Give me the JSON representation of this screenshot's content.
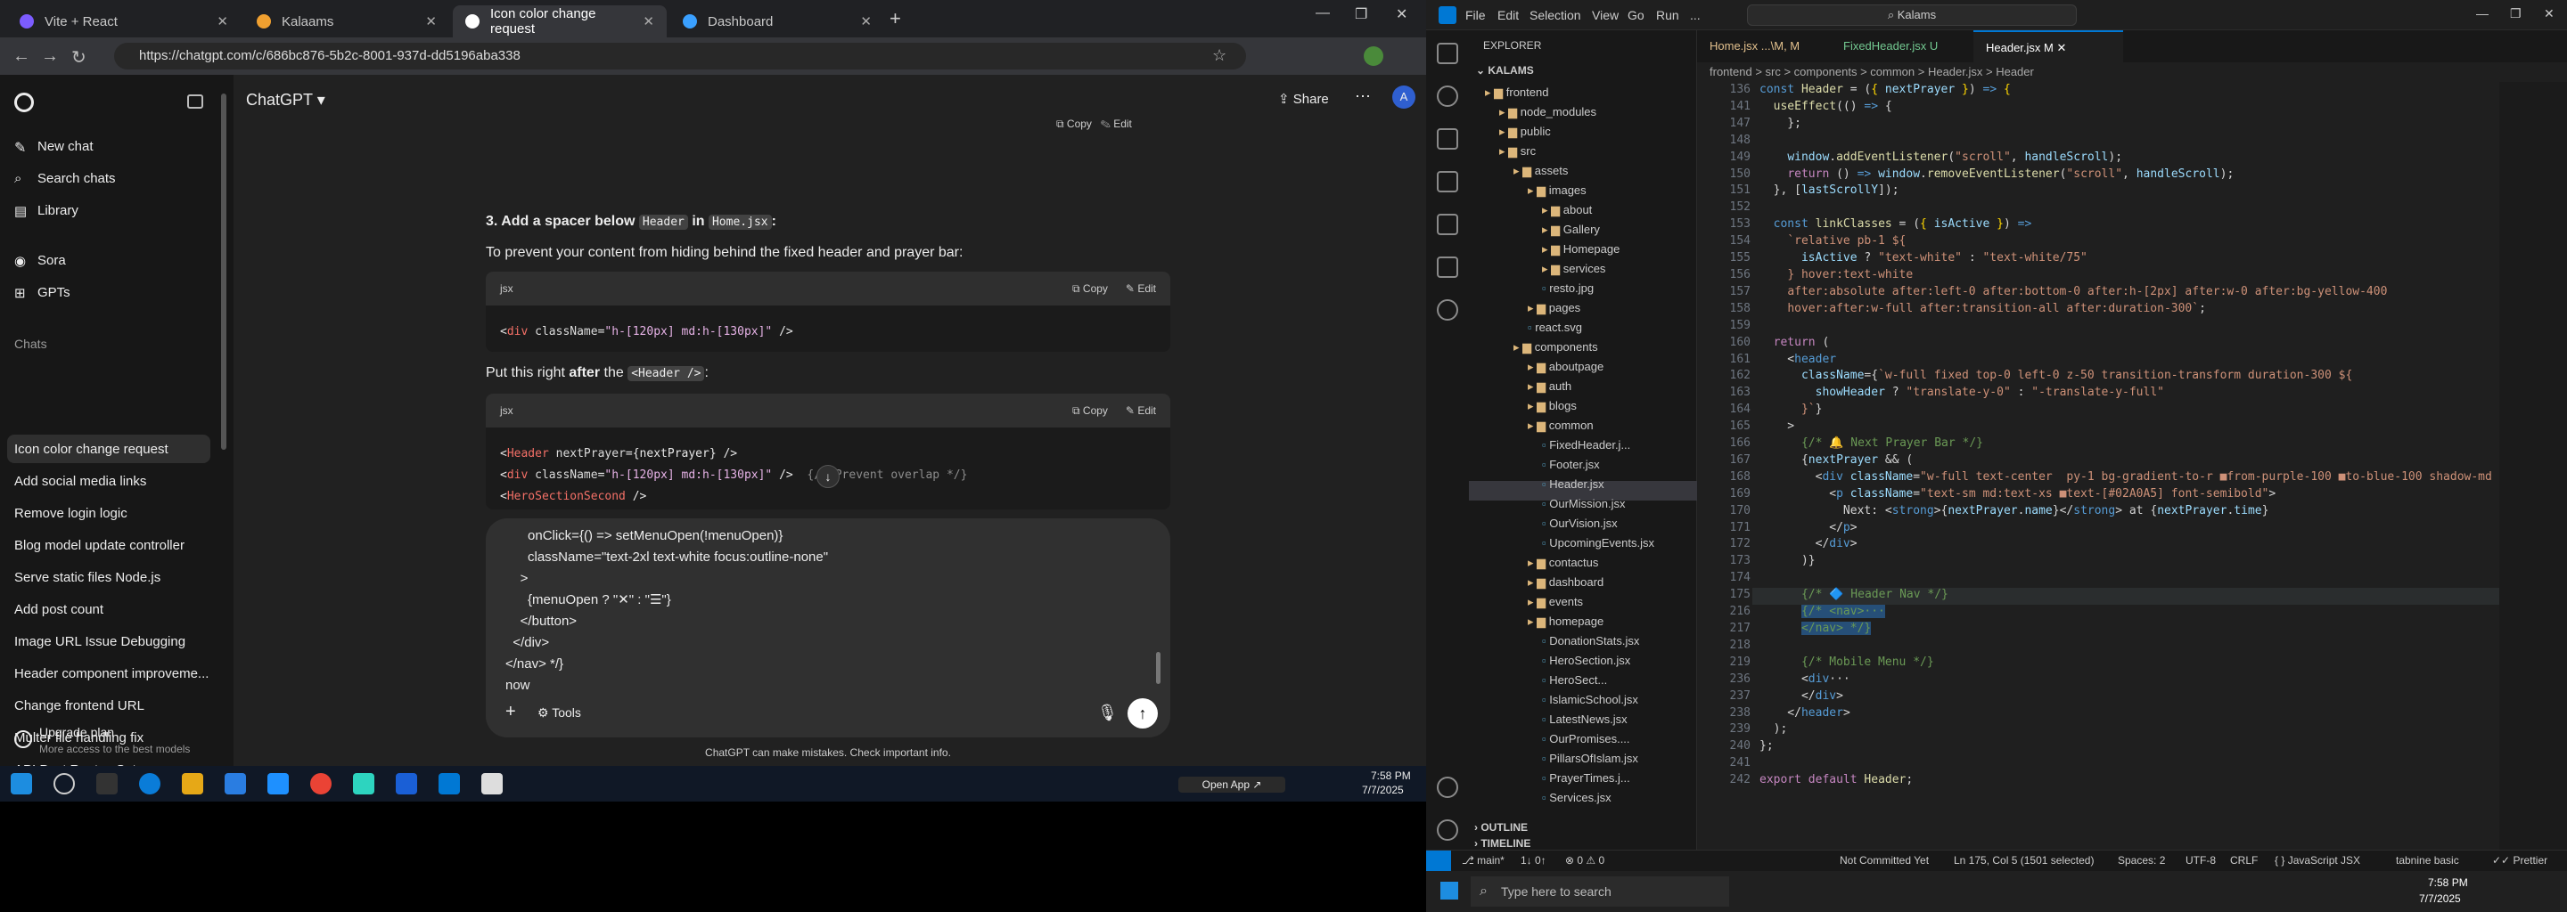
{
  "browser": {
    "tabs": [
      "Vite + React",
      "Kalaams",
      "Icon color change request",
      "Dashboard"
    ],
    "url": "https://chatgpt.com/c/686bc876-5b2c-8001-937d-dd5196aba338"
  },
  "chatgpt": {
    "brand": "ChatGPT",
    "nav": [
      "New chat",
      "Search chats",
      "Library",
      "Sora",
      "GPTs"
    ],
    "chats_heading": "Chats",
    "chats": [
      "Icon color change request",
      "Add social media links",
      "Remove login logic",
      "Blog model update controller",
      "Serve static files Node.js",
      "Add post count",
      "Image URL Issue Debugging",
      "Header component improveme...",
      "Change frontend URL",
      "Multer file handling fix",
      "API Post Routes Setup"
    ],
    "upgrade": {
      "title": "Upgrade plan",
      "sub": "More access to the best models"
    },
    "share": "Share",
    "avatar": "A",
    "copy": "Copy",
    "edit": "Edit",
    "lang": "jsx",
    "step_heading": "3. Add a spacer below ",
    "step_code1": "Header",
    "step_in": " in ",
    "step_code2": "Home.jsx",
    "step_colon": ":",
    "step_desc": "To prevent your content from hiding behind the fixed header and prayer bar:",
    "put_this_pre": "Put this right ",
    "put_this_bold": "after",
    "put_this_post": " the ",
    "put_this_code": "<Header />",
    "put_this_end": ":",
    "compose_text": "      onClick={() => setMenuOpen(!menuOpen)}\n      className=\"text-2xl text-white focus:outline-none\"\n    >\n      {menuOpen ? \"✕\" : \"☰\"}\n    </button>\n  </div>\n</nav> */}\nnow",
    "tools": "Tools",
    "disclaimer": "ChatGPT can make mistakes. Check important info."
  },
  "taskbar": {
    "time": "7:58 PM",
    "date": "7/7/2025",
    "open_app": "Open App ↗",
    "search": "Type here to search"
  },
  "vscode": {
    "menu": [
      "File",
      "Edit",
      "Selection",
      "View",
      "Go",
      "Run",
      "..."
    ],
    "search": "Kalams",
    "explorer": "EXPLORER",
    "root": "KALAMS",
    "tree": [
      {
        "n": "frontend",
        "d": 0,
        "f": 1
      },
      {
        "n": "node_modules",
        "d": 1,
        "f": 1
      },
      {
        "n": "public",
        "d": 1,
        "f": 1
      },
      {
        "n": "src",
        "d": 1,
        "f": 1
      },
      {
        "n": "assets",
        "d": 2,
        "f": 1
      },
      {
        "n": "images",
        "d": 3,
        "f": 1
      },
      {
        "n": "about",
        "d": 4,
        "f": 1
      },
      {
        "n": "Gallery",
        "d": 4,
        "f": 1
      },
      {
        "n": "Homepage",
        "d": 4,
        "f": 1
      },
      {
        "n": "services",
        "d": 4,
        "f": 1
      },
      {
        "n": "resto.jpg",
        "d": 4,
        "f": 0
      },
      {
        "n": "pages",
        "d": 3,
        "f": 1
      },
      {
        "n": "react.svg",
        "d": 3,
        "f": 0
      },
      {
        "n": "components",
        "d": 2,
        "f": 1
      },
      {
        "n": "aboutpage",
        "d": 3,
        "f": 1
      },
      {
        "n": "auth",
        "d": 3,
        "f": 1
      },
      {
        "n": "blogs",
        "d": 3,
        "f": 1
      },
      {
        "n": "common",
        "d": 3,
        "f": 1
      },
      {
        "n": "FixedHeader.j...",
        "d": 4,
        "f": 0
      },
      {
        "n": "Footer.jsx",
        "d": 4,
        "f": 0
      },
      {
        "n": "Header.jsx",
        "d": 4,
        "f": 0
      },
      {
        "n": "OurMission.jsx",
        "d": 4,
        "f": 0
      },
      {
        "n": "OurVision.jsx",
        "d": 4,
        "f": 0
      },
      {
        "n": "UpcomingEvents.jsx",
        "d": 4,
        "f": 0
      },
      {
        "n": "contactus",
        "d": 3,
        "f": 1
      },
      {
        "n": "dashboard",
        "d": 3,
        "f": 1
      },
      {
        "n": "events",
        "d": 3,
        "f": 1
      },
      {
        "n": "homepage",
        "d": 3,
        "f": 1
      },
      {
        "n": "DonationStats.jsx",
        "d": 4,
        "f": 0
      },
      {
        "n": "HeroSection.jsx",
        "d": 4,
        "f": 0
      },
      {
        "n": "HeroSect...",
        "d": 4,
        "f": 0
      },
      {
        "n": "IslamicSchool.jsx",
        "d": 4,
        "f": 0
      },
      {
        "n": "LatestNews.jsx",
        "d": 4,
        "f": 0
      },
      {
        "n": "OurPromises....",
        "d": 4,
        "f": 0
      },
      {
        "n": "PillarsOfIslam.jsx",
        "d": 4,
        "f": 0
      },
      {
        "n": "PrayerTimes.j...",
        "d": 4,
        "f": 0
      },
      {
        "n": "Services.jsx",
        "d": 4,
        "f": 0
      }
    ],
    "outline": "OUTLINE",
    "timeline": "TIMELINE",
    "tabs": [
      "Home.jsx  ...\\M, M",
      "FixedHeader.jsx  U",
      "Header.jsx  M"
    ],
    "breadcrumb": "frontend > src > components > common > Header.jsx > Header",
    "line_numbers": "136\n141\n147\n148\n149\n150\n151\n152\n153\n154\n155\n156\n157\n158\n159\n160\n161\n162\n163\n164\n165\n166\n167\n168\n169\n170\n171\n172\n173\n174\n175\n216\n217\n218\n219\n236\n237\n238\n239\n240\n241\n242",
    "status": {
      "branch": "main*",
      "sync": "1↓ 0↑",
      "problems": "⊗ 0 ⚠ 0",
      "nc": "Not Committed Yet",
      "pos": "Ln 175, Col 5 (1501 selected)",
      "spaces": "Spaces: 2",
      "enc": "UTF-8",
      "eol": "CRLF",
      "lang": "JavaScript JSX",
      "tabnine": "tabnine basic",
      "prettier": "Prettier"
    }
  }
}
